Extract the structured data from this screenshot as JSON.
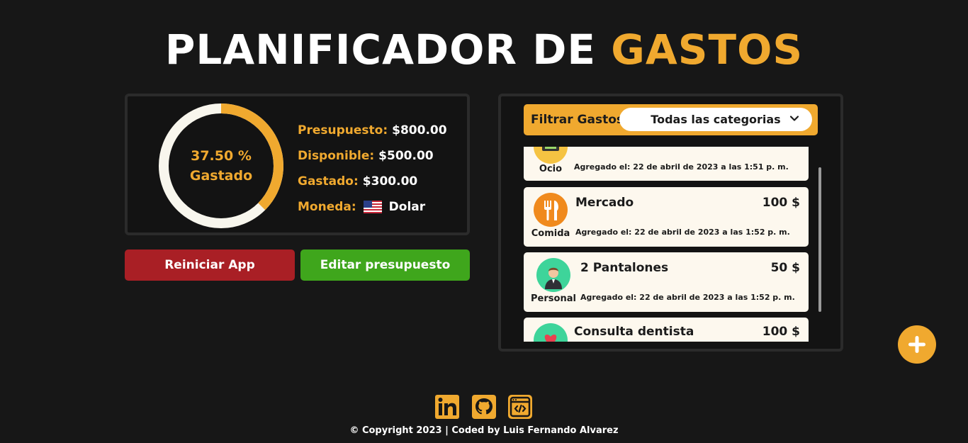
{
  "header": {
    "title_main": "PLANIFICADOR DE",
    "title_accent": "GASTOS"
  },
  "budget": {
    "progress_percent": 37.5,
    "percent_label": "37.50 %",
    "spent_word": "Gastado",
    "rows": [
      {
        "label": "Presupuesto:",
        "value": "$800.00"
      },
      {
        "label": "Disponible:",
        "value": "$500.00"
      },
      {
        "label": "Gastado:",
        "value": "$300.00"
      },
      {
        "label": "Moneda:",
        "value": "Dolar"
      }
    ]
  },
  "buttons": {
    "reset": "Reiniciar App",
    "edit": "Editar presupuesto"
  },
  "filter": {
    "label": "Filtrar Gastos",
    "selected": "Todas las categorias"
  },
  "expenses": [
    {
      "category": "Ocio",
      "name": "",
      "amount": "",
      "date": "Agregado el: 22 de abril de 2023 a las 1:51 p. m."
    },
    {
      "category": "Comida",
      "name": "Mercado",
      "amount": "100 $",
      "date": "Agregado el: 22 de abril de 2023 a las 1:52 p. m."
    },
    {
      "category": "Personal",
      "name": "2 Pantalones",
      "amount": "50 $",
      "date": "Agregado el: 22 de abril de 2023 a las 1:52 p. m."
    },
    {
      "category": "",
      "name": "Consulta dentista",
      "amount": "100 $",
      "date": ""
    }
  ],
  "footer": {
    "text": "© Copyright 2023 | Coded by Luis Fernando Alvarez"
  },
  "icons": [
    "linkedin-icon",
    "github-icon",
    "code-window-icon",
    "plus-icon"
  ],
  "colors": {
    "accent": "#f0a92f",
    "reset": "#a91f25",
    "edit": "#3fa61c",
    "background": "#171717",
    "card": "#fdf8ee"
  }
}
